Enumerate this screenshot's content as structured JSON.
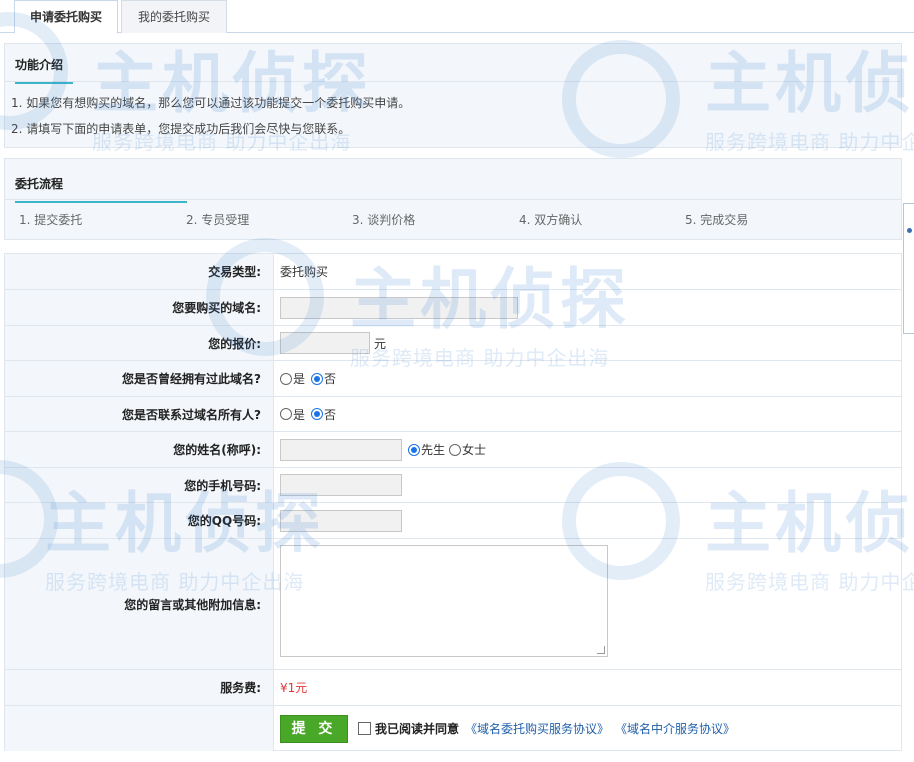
{
  "tabs": [
    {
      "label": "申请委托购买",
      "active": true
    },
    {
      "label": "我的委托购买",
      "active": false
    }
  ],
  "intro": {
    "title": "功能介绍",
    "lines": [
      "1. 如果您有想购买的域名，那么您可以通过该功能提交一个委托购买申请。",
      "2. 请填写下面的申请表单，您提交成功后我们会尽快与您联系。"
    ]
  },
  "flow": {
    "title": "委托流程",
    "steps": [
      "1. 提交委托",
      "2. 专员受理",
      "3. 谈判价格",
      "4. 双方确认",
      "5. 完成交易"
    ]
  },
  "form": {
    "trade_type_label": "交易类型:",
    "trade_type_value": "委托购买",
    "domain_label": "您要购买的域名:",
    "price_label": "您的报价:",
    "price_unit": "元",
    "owned_label": "您是否曾经拥有过此域名?",
    "contacted_label": "您是否联系过域名所有人?",
    "yes": "是",
    "no": "否",
    "name_label": "您的姓名(称呼):",
    "mr": "先生",
    "ms": "女士",
    "phone_label": "您的手机号码:",
    "qq_label": "您的QQ号码:",
    "message_label": "您的留言或其他附加信息:",
    "fee_label": "服务费:",
    "fee_value": "¥1元",
    "submit_label": "提 交",
    "agree_text": "我已阅读并同意",
    "agreement1": "《域名委托购买服务协议》",
    "agreement2": "《域名中介服务协议》"
  },
  "watermark": {
    "logo": "主机侦探",
    "slogan": "服务跨境电商 助力中企出海"
  },
  "colors": {
    "accent_underline": "#3ab6c8",
    "fee_red": "#e4393c",
    "submit_green": "#4aa828",
    "link_blue": "#1f5fa8",
    "radio_blue": "#1a73e8"
  }
}
